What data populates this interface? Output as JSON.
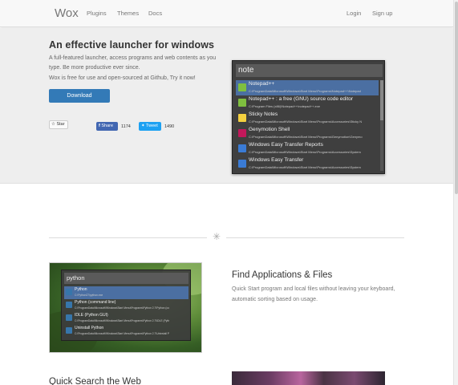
{
  "nav": {
    "brand": "Wox",
    "links": [
      "Plugins",
      "Themes",
      "Docs"
    ],
    "login": "Login",
    "signup": "Sign up"
  },
  "hero": {
    "title": "An effective launcher for windows",
    "description": "A full-featured launcher, access programs and web contents as you type. Be more productive ever since.",
    "free_text": "Wox is free for use and open-sourced at Github, Try it now!",
    "download_label": "Download",
    "star_label": "Star",
    "share_label": "Share",
    "share_count": "1174",
    "tweet_label": "Tweet",
    "tweet_count": "1490"
  },
  "launcher": {
    "query": "note",
    "results": [
      {
        "title": "Notepad++",
        "subtitle": "C:\\ProgramData\\Microsoft\\Windows\\Start Menu\\Programs\\Notepad++\\Notepad",
        "icon": "notepad-plus-icon",
        "color": "#7fbf3f"
      },
      {
        "title": "Notepad++ : a free (GNU) source code editor",
        "subtitle": "C:\\Program Files (x86)\\Notepad++\\notepad++.exe",
        "icon": "notepad-plus-icon",
        "color": "#7fbf3f"
      },
      {
        "title": "Sticky Notes",
        "subtitle": "C:\\ProgramData\\Microsoft\\Windows\\Start Menu\\Programs\\Accessories\\Sticky N",
        "icon": "sticky-notes-icon",
        "color": "#f4d03f"
      },
      {
        "title": "Genymotion Shell",
        "subtitle": "C:\\ProgramData\\Microsoft\\Windows\\Start Menu\\Programs\\Genymotion\\Genymo",
        "icon": "genymotion-shell-icon",
        "color": "#c2185b"
      },
      {
        "title": "Windows Easy Transfer Reports",
        "subtitle": "C:\\ProgramData\\Microsoft\\Windows\\Start Menu\\Programs\\Accessories\\System",
        "icon": "easy-transfer-icon",
        "color": "#3a7bd5"
      },
      {
        "title": "Windows Easy Transfer",
        "subtitle": "C:\\ProgramData\\Microsoft\\Windows\\Start Menu\\Programs\\Accessories\\System",
        "icon": "easy-transfer-icon",
        "color": "#3a7bd5"
      }
    ]
  },
  "feature1": {
    "title": "Find Applications & Files",
    "description": "Quick Start program and local files without leaving your keyboard, automatic sorting based on usage.",
    "launcher": {
      "query": "python",
      "results": [
        {
          "title": "Python",
          "subtitle": "C:\\Python27\\python.exe",
          "icon": "python-icon",
          "color": "#3776ab"
        },
        {
          "title": "Python (command line)",
          "subtitle": "C:\\ProgramData\\Microsoft\\Windows\\Start Menu\\Programs\\Python 2.7\\Python (co",
          "icon": "python-icon",
          "color": "#3776ab"
        },
        {
          "title": "IDLE (Python GUI)",
          "subtitle": "C:\\ProgramData\\Microsoft\\Windows\\Start Menu\\Programs\\Python 2.7\\IDLE (Pyth",
          "icon": "python-icon",
          "color": "#3776ab"
        },
        {
          "title": "Uninstall Python",
          "subtitle": "C:\\ProgramData\\Microsoft\\Windows\\Start Menu\\Programs\\Python 2.7\\Uninstall P",
          "icon": "python-icon",
          "color": "#3776ab"
        }
      ]
    }
  },
  "section2": {
    "title": "Quick Search the Web"
  }
}
